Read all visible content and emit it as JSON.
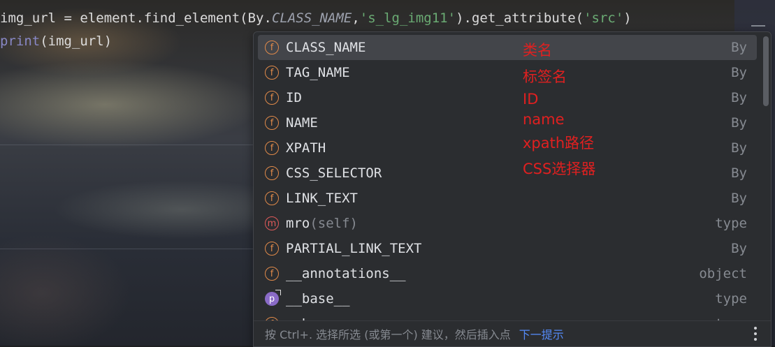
{
  "editor": {
    "line1": {
      "a": "img_url = element.find_element(By.",
      "b": "CLASS_NAME",
      "c": ",",
      "d": "'s_lg_img11'",
      "e": ").get_attribute(",
      "f": "'src'",
      "g": ")"
    },
    "line2": {
      "a": "print",
      "b": "(img_url)"
    }
  },
  "popup": {
    "items": [
      {
        "kind": "f",
        "name": "CLASS_NAME",
        "params": "",
        "type": "By",
        "selected": true
      },
      {
        "kind": "f",
        "name": "TAG_NAME",
        "params": "",
        "type": "By"
      },
      {
        "kind": "f",
        "name": "ID",
        "params": "",
        "type": "By"
      },
      {
        "kind": "f",
        "name": "NAME",
        "params": "",
        "type": "By"
      },
      {
        "kind": "f",
        "name": "XPATH",
        "params": "",
        "type": "By"
      },
      {
        "kind": "f",
        "name": "CSS_SELECTOR",
        "params": "",
        "type": "By"
      },
      {
        "kind": "f",
        "name": "LINK_TEXT",
        "params": "",
        "type": "By"
      },
      {
        "kind": "m",
        "name": "mro",
        "params": "(self)",
        "type": "type"
      },
      {
        "kind": "f",
        "name": "PARTIAL_LINK_TEXT",
        "params": "",
        "type": "By"
      },
      {
        "kind": "f",
        "name": "__annotations__",
        "params": "",
        "type": "object"
      },
      {
        "kind": "p",
        "name": "__base__",
        "params": "",
        "type": "type"
      },
      {
        "kind": "f",
        "name": "__bases__",
        "params": "",
        "type": "type"
      }
    ],
    "footer": {
      "hint": "按 Ctrl+. 选择所选 (或第一个) 建议，然后插入点",
      "next_tip": "下一提示"
    }
  },
  "annotations": {
    "class_name": "类名",
    "tag_name": "标签名",
    "id": "ID",
    "name": "name",
    "xpath": "xpath路径",
    "css": "CSS选择器"
  },
  "colors": {
    "annotation": "#e02020",
    "field_icon": "#e08a4a",
    "method_icon": "#e05a5a",
    "property_icon": "#8a6bc7",
    "link": "#548af7"
  }
}
